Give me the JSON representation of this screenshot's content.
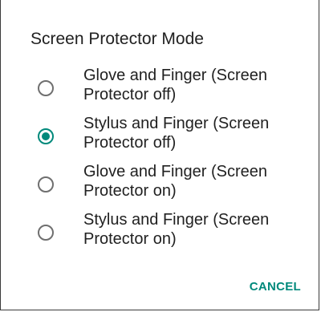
{
  "dialog": {
    "title": "Screen Protector Mode",
    "options": [
      {
        "label": "Glove and Finger (Screen Protector off)",
        "selected": false
      },
      {
        "label": "Stylus and Finger (Screen Protector off)",
        "selected": true
      },
      {
        "label": "Glove and Finger (Screen Protector on)",
        "selected": false
      },
      {
        "label": "Stylus and Finger (Screen Protector on)",
        "selected": false
      }
    ],
    "cancel_label": "CANCEL"
  },
  "colors": {
    "accent": "#00897b",
    "text": "#212121",
    "radio_unchecked": "#6f6f6f",
    "background": "#ffffff"
  },
  "icons": {
    "radio_unchecked": "radio-unchecked-icon",
    "radio_checked": "radio-checked-icon"
  }
}
